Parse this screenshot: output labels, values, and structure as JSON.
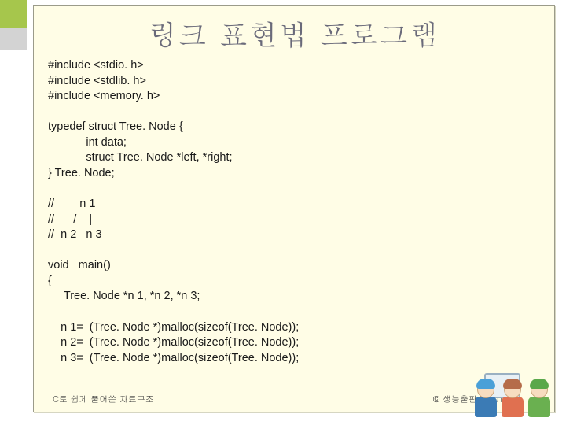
{
  "title": "링크 표현법 프로그램",
  "code_lines": [
    "#include <stdio. h>",
    "#include <stdlib. h>",
    "#include <memory. h>",
    "",
    "typedef struct Tree. Node {",
    "            int data;",
    "            struct Tree. Node *left, *right;",
    "} Tree. Node;",
    "",
    "//        n 1",
    "//      /    |",
    "//  n 2   n 3",
    "",
    "void   main()",
    "{",
    "     Tree. Node *n 1, *n 2, *n 3;",
    "",
    "    n 1=  (Tree. Node *)malloc(sizeof(Tree. Node));",
    "    n 2=  (Tree. Node *)malloc(sizeof(Tree. Node));",
    "    n 3=  (Tree. Node *)malloc(sizeof(Tree. Node));"
  ],
  "footer_left": "C로 쉽게 풀어쓴 자료구조",
  "footer_right": "© 생능출판사 2011"
}
